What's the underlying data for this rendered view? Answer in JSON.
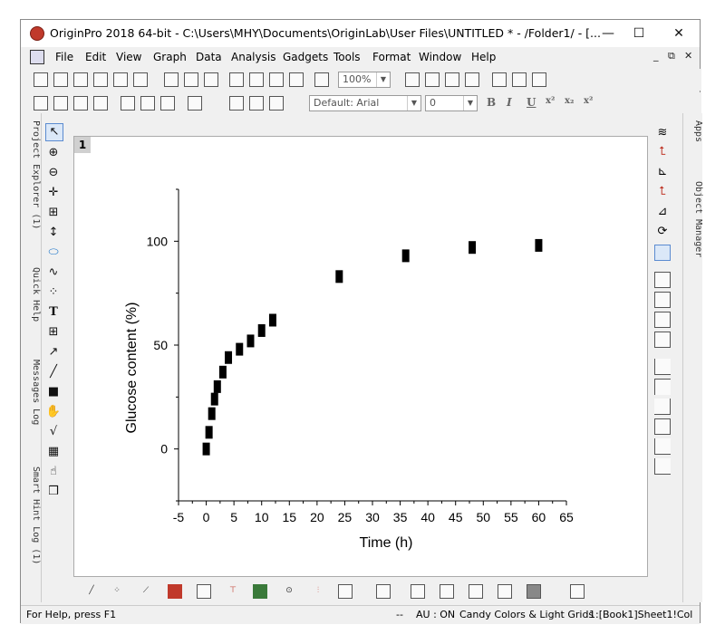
{
  "window": {
    "title": "OriginPro 2018 64-bit - C:\\Users\\MHY\\Documents\\OriginLab\\User Files\\UNTITLED * - /Folder1/ - [...",
    "minimize": "—",
    "maximize": "☐",
    "close": "✕"
  },
  "menu": {
    "items": [
      "File",
      "Edit",
      "View",
      "Graph",
      "Data",
      "Analysis",
      "Gadgets",
      "Tools",
      "Format",
      "Window",
      "Help"
    ]
  },
  "toolbar": {
    "zoom": "100%",
    "font_name": "Default: Arial",
    "font_size": "0",
    "bold": "B",
    "italic": "I",
    "underline": "U"
  },
  "left_dock": {
    "tabs": [
      "Project Explorer (1)",
      "Quick Help",
      "Messages Log",
      "Smart Hint Log (1)"
    ]
  },
  "right_dock": {
    "tabs": [
      "Apps",
      "Object Manager"
    ]
  },
  "graph_window": {
    "number": "1"
  },
  "status": {
    "help": "For Help, press F1",
    "sep": "--",
    "au": "AU : ON",
    "theme": "Candy Colors & Light Grids",
    "book": "1:[Book1]Sheet1!Col"
  },
  "colors": {
    "marker": "#000000",
    "axis": "#000000",
    "background": "#ffffff"
  },
  "chart_data": {
    "type": "scatter",
    "xlabel": "Time (h)",
    "ylabel": "Glucose content (%)",
    "xlim": [
      -5,
      65
    ],
    "ylim": [
      -25,
      125
    ],
    "xticks": [
      -5,
      0,
      5,
      10,
      15,
      20,
      25,
      30,
      35,
      40,
      45,
      50,
      55,
      60,
      65
    ],
    "yticks": [
      0,
      50,
      100
    ],
    "grid": false,
    "legend": "none",
    "marker": "square",
    "x": [
      0,
      0.5,
      1,
      1.5,
      2,
      3,
      4,
      6,
      8,
      10,
      12,
      24,
      36,
      48,
      60
    ],
    "y": [
      0,
      8,
      17,
      24,
      30,
      37,
      44,
      48,
      52,
      57,
      62,
      83,
      93,
      97,
      98
    ]
  }
}
